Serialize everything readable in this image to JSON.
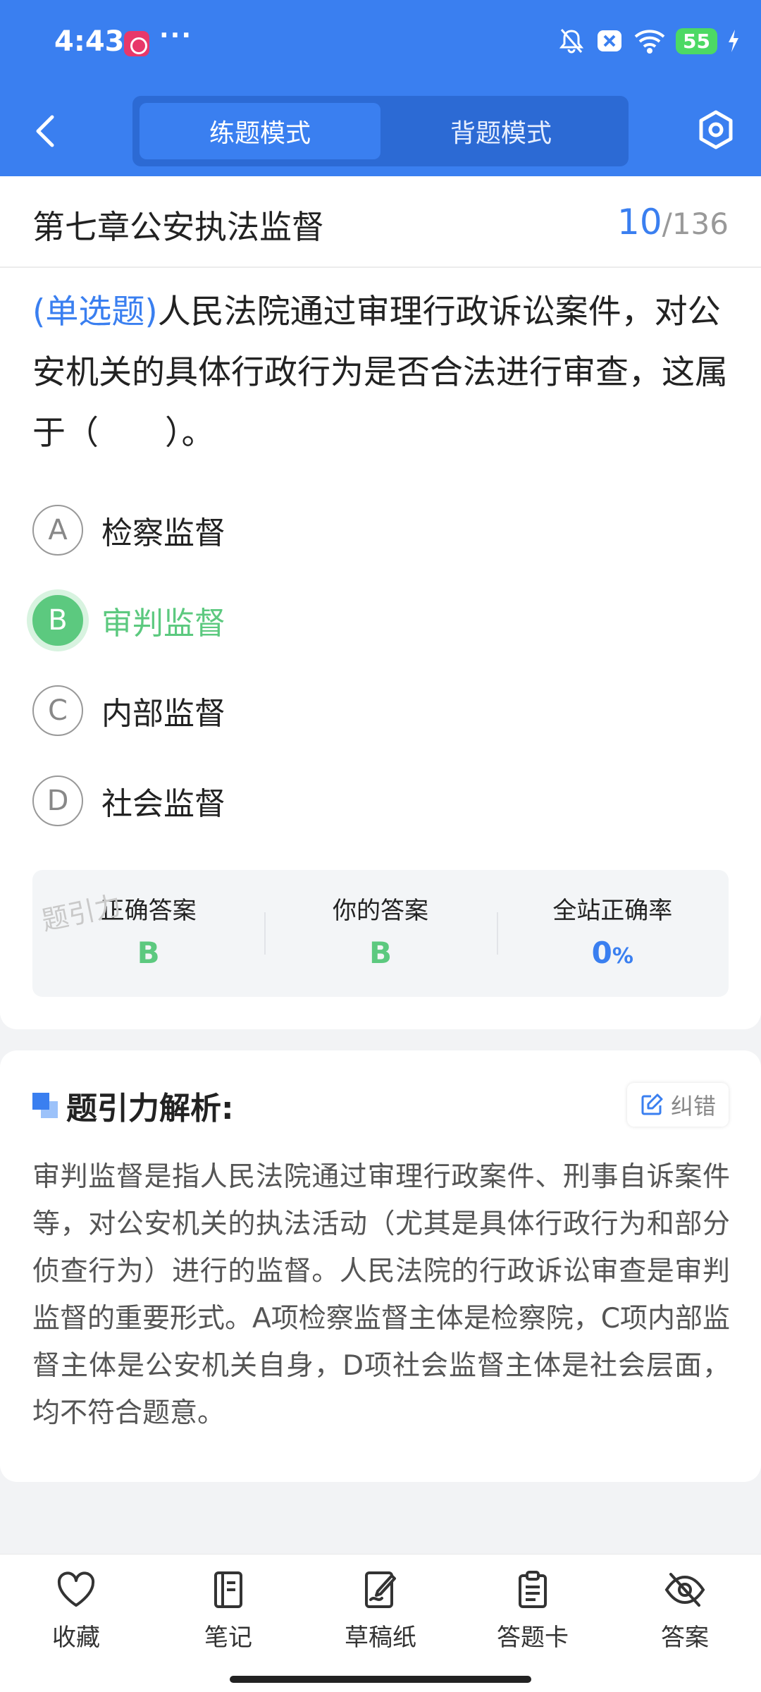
{
  "status_bar": {
    "time": "4:43",
    "dots": "···",
    "battery": "55"
  },
  "header": {
    "modes": [
      {
        "label": "练题模式"
      },
      {
        "label": "背题模式"
      }
    ]
  },
  "chapter": {
    "title": "第七章公安执法监督",
    "current": "10",
    "separator": "/",
    "total": "136"
  },
  "question": {
    "type": "(单选题)",
    "text": "人民法院通过审理行政诉讼案件，对公安机关的具体行政行为是否合法进行审查，这属于（　　）。"
  },
  "options": [
    {
      "letter": "A",
      "text": "检察监督"
    },
    {
      "letter": "B",
      "text": "审判监督"
    },
    {
      "letter": "C",
      "text": "内部监督"
    },
    {
      "letter": "D",
      "text": "社会监督"
    }
  ],
  "answer": {
    "correct_label": "正确答案",
    "correct_value": "B",
    "yours_label": "你的答案",
    "yours_value": "B",
    "rate_label": "全站正确率",
    "rate_value": "0",
    "rate_unit": "%",
    "watermark": "题引力"
  },
  "explanation": {
    "title": "题引力解析:",
    "report_label": "纠错",
    "body": "审判监督是指人民法院通过审理行政案件、刑事自诉案件等，对公安机关的执法活动（尤其是具体行政行为和部分侦查行为）进行的监督。人民法院的行政诉讼审查是审判监督的重要形式。A项检察监督主体是检察院，C项内部监督主体是公安机关自身，D项社会监督主体是社会层面，均不符合题意。"
  },
  "toolbar": [
    {
      "label": "收藏"
    },
    {
      "label": "笔记"
    },
    {
      "label": "草稿纸"
    },
    {
      "label": "答题卡"
    },
    {
      "label": "答案"
    }
  ],
  "colors": {
    "primary": "#3a7ff0",
    "correct": "#5cc97f"
  }
}
